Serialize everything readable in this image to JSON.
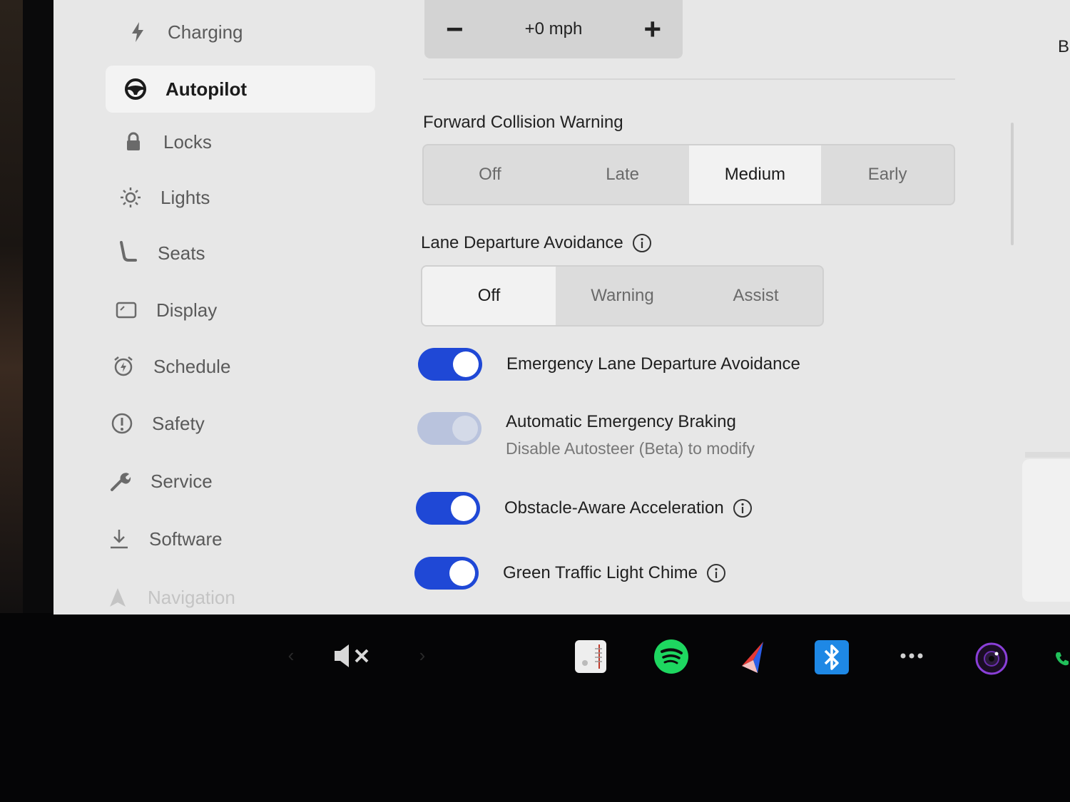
{
  "sidebar": {
    "items": [
      {
        "label": "Charging",
        "icon": "bolt-icon"
      },
      {
        "label": "Autopilot",
        "icon": "steering-wheel-icon",
        "active": true
      },
      {
        "label": "Locks",
        "icon": "lock-icon"
      },
      {
        "label": "Lights",
        "icon": "light-bulb-icon"
      },
      {
        "label": "Seats",
        "icon": "seat-icon"
      },
      {
        "label": "Display",
        "icon": "display-icon"
      },
      {
        "label": "Schedule",
        "icon": "alarm-clock-icon"
      },
      {
        "label": "Safety",
        "icon": "exclamation-circle-icon"
      },
      {
        "label": "Service",
        "icon": "wrench-icon"
      },
      {
        "label": "Software",
        "icon": "download-icon"
      },
      {
        "label": "Navigation",
        "icon": "navigation-arrow-icon"
      }
    ]
  },
  "speed_offset": {
    "minus_label": "−",
    "value": "+0 mph",
    "plus_label": "+"
  },
  "forward_collision_warning": {
    "label": "Forward Collision Warning",
    "options": [
      "Off",
      "Late",
      "Medium",
      "Early"
    ],
    "selected": "Medium"
  },
  "lane_departure_avoidance": {
    "label": "Lane Departure Avoidance",
    "options": [
      "Off",
      "Warning",
      "Assist"
    ],
    "selected": "Off"
  },
  "toggles": [
    {
      "title": "Emergency Lane Departure Avoidance",
      "on": true,
      "disabled": false,
      "info": false
    },
    {
      "title": "Automatic Emergency Braking",
      "subtitle": "Disable Autosteer (Beta) to modify",
      "on": true,
      "disabled": true,
      "info": false
    },
    {
      "title": "Obstacle-Aware Acceleration",
      "on": true,
      "disabled": false,
      "info": true
    },
    {
      "title": "Green Traffic Light Chime",
      "on": true,
      "disabled": false,
      "info": true
    }
  ],
  "right_edge_text": "B",
  "taskbar": {
    "items": [
      "volume-mute-icon",
      "radio-icon",
      "spotify-icon",
      "navigation-icon",
      "bluetooth-icon",
      "more-icon",
      "camera-icon",
      "phone-icon"
    ]
  },
  "colors": {
    "toggle_on": "#1f48d6",
    "toggle_disabled": "#b9c3dd",
    "spotify": "#1ed760",
    "bluetooth": "#1e88e5",
    "screen_bg": "#e7e7e7"
  }
}
